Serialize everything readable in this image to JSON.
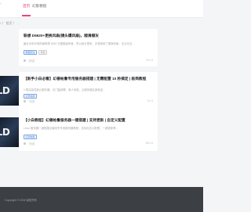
{
  "nav": {
    "tabs": [
      {
        "label": "首页",
        "active": true
      },
      {
        "label": "幻影教程",
        "active": false
      }
    ]
  },
  "breadcrumb": "/ 〉 首页 〉 ...",
  "cards": [
    {
      "title": "联想 D5920+更换风扇(镜头爆风扇)，顺滑顺灰",
      "desc": "最近手机坏掉风扇联想 5920 无限模组声音，所以就手里来。手里就转了更换风扇，无法无法...",
      "tags": [
        "教程测试",
        "风扇"
      ],
      "meta_views": "3天前",
      "meta_right": "70 ⊙1"
    },
    {
      "title": "【新手小白必看】幻兽帕鲁专用服务器搭建 | 无需配置 10 秒搞定 | 极简教程",
      "desc": "1.购买高性能云服务器，无门槛部署，新人特惠，云服务器注册就送...",
      "tags": [
        "幻兽帕鲁"
      ],
      "meta_views": "7天前",
      "meta_right": "3 ⊙1"
    },
    {
      "title": "【小白教程】幻兽帕鲁服务器一键搭建 | 支持更新 | 自定义配置",
      "desc": "Linux 服务器一键搭建幻兽帕鲁专用服务器教程，支持自定义配置，一键更新等...",
      "tags": [
        "幻兽帕鲁"
      ],
      "meta_views": "7天前",
      "meta_right": "69 ⊙1"
    }
  ],
  "thumbs": [
    {
      "word": "RLD"
    },
    {
      "word": "RLD"
    }
  ],
  "footer": {
    "text": "Copyright © 2024 版权所有"
  }
}
